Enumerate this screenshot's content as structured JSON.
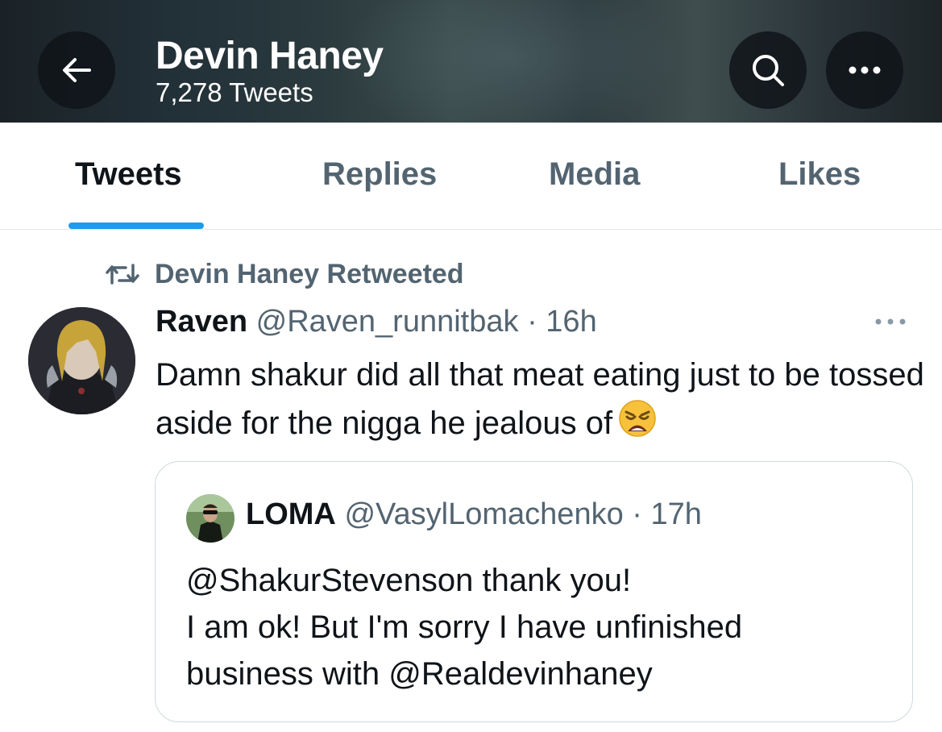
{
  "header": {
    "title": "Devin Haney",
    "subtitle": "7,278 Tweets",
    "icons": {
      "back": "arrow-left-icon",
      "search": "search-icon",
      "more": "more-horizontal-icon"
    }
  },
  "tabs": [
    {
      "label": "Tweets",
      "active": true
    },
    {
      "label": "Replies",
      "active": false
    },
    {
      "label": "Media",
      "active": false
    },
    {
      "label": "Likes",
      "active": false
    }
  ],
  "tweet": {
    "retweet_label": "Devin Haney Retweeted",
    "author_name": "Raven",
    "author_handle": "@Raven_runnitbak",
    "separator": " · ",
    "time": "16h",
    "text": "Damn shakur did all that meat eating just to be tossed aside for the nigga he jealous of",
    "emoji": "weary-face",
    "quoted": {
      "author_name": "LOMA",
      "author_handle": "@VasylLomachenko",
      "separator": " · ",
      "time": "17h",
      "lines": [
        "@ShakurStevenson  thank you!",
        "I am ok! But I'm sorry I have unfinished",
        "business with @Realdevinhaney"
      ]
    }
  },
  "colors": {
    "accent": "#1d9bf0",
    "secondary_text": "#536471",
    "primary_text": "#0f1419",
    "border": "#cfd9de"
  }
}
